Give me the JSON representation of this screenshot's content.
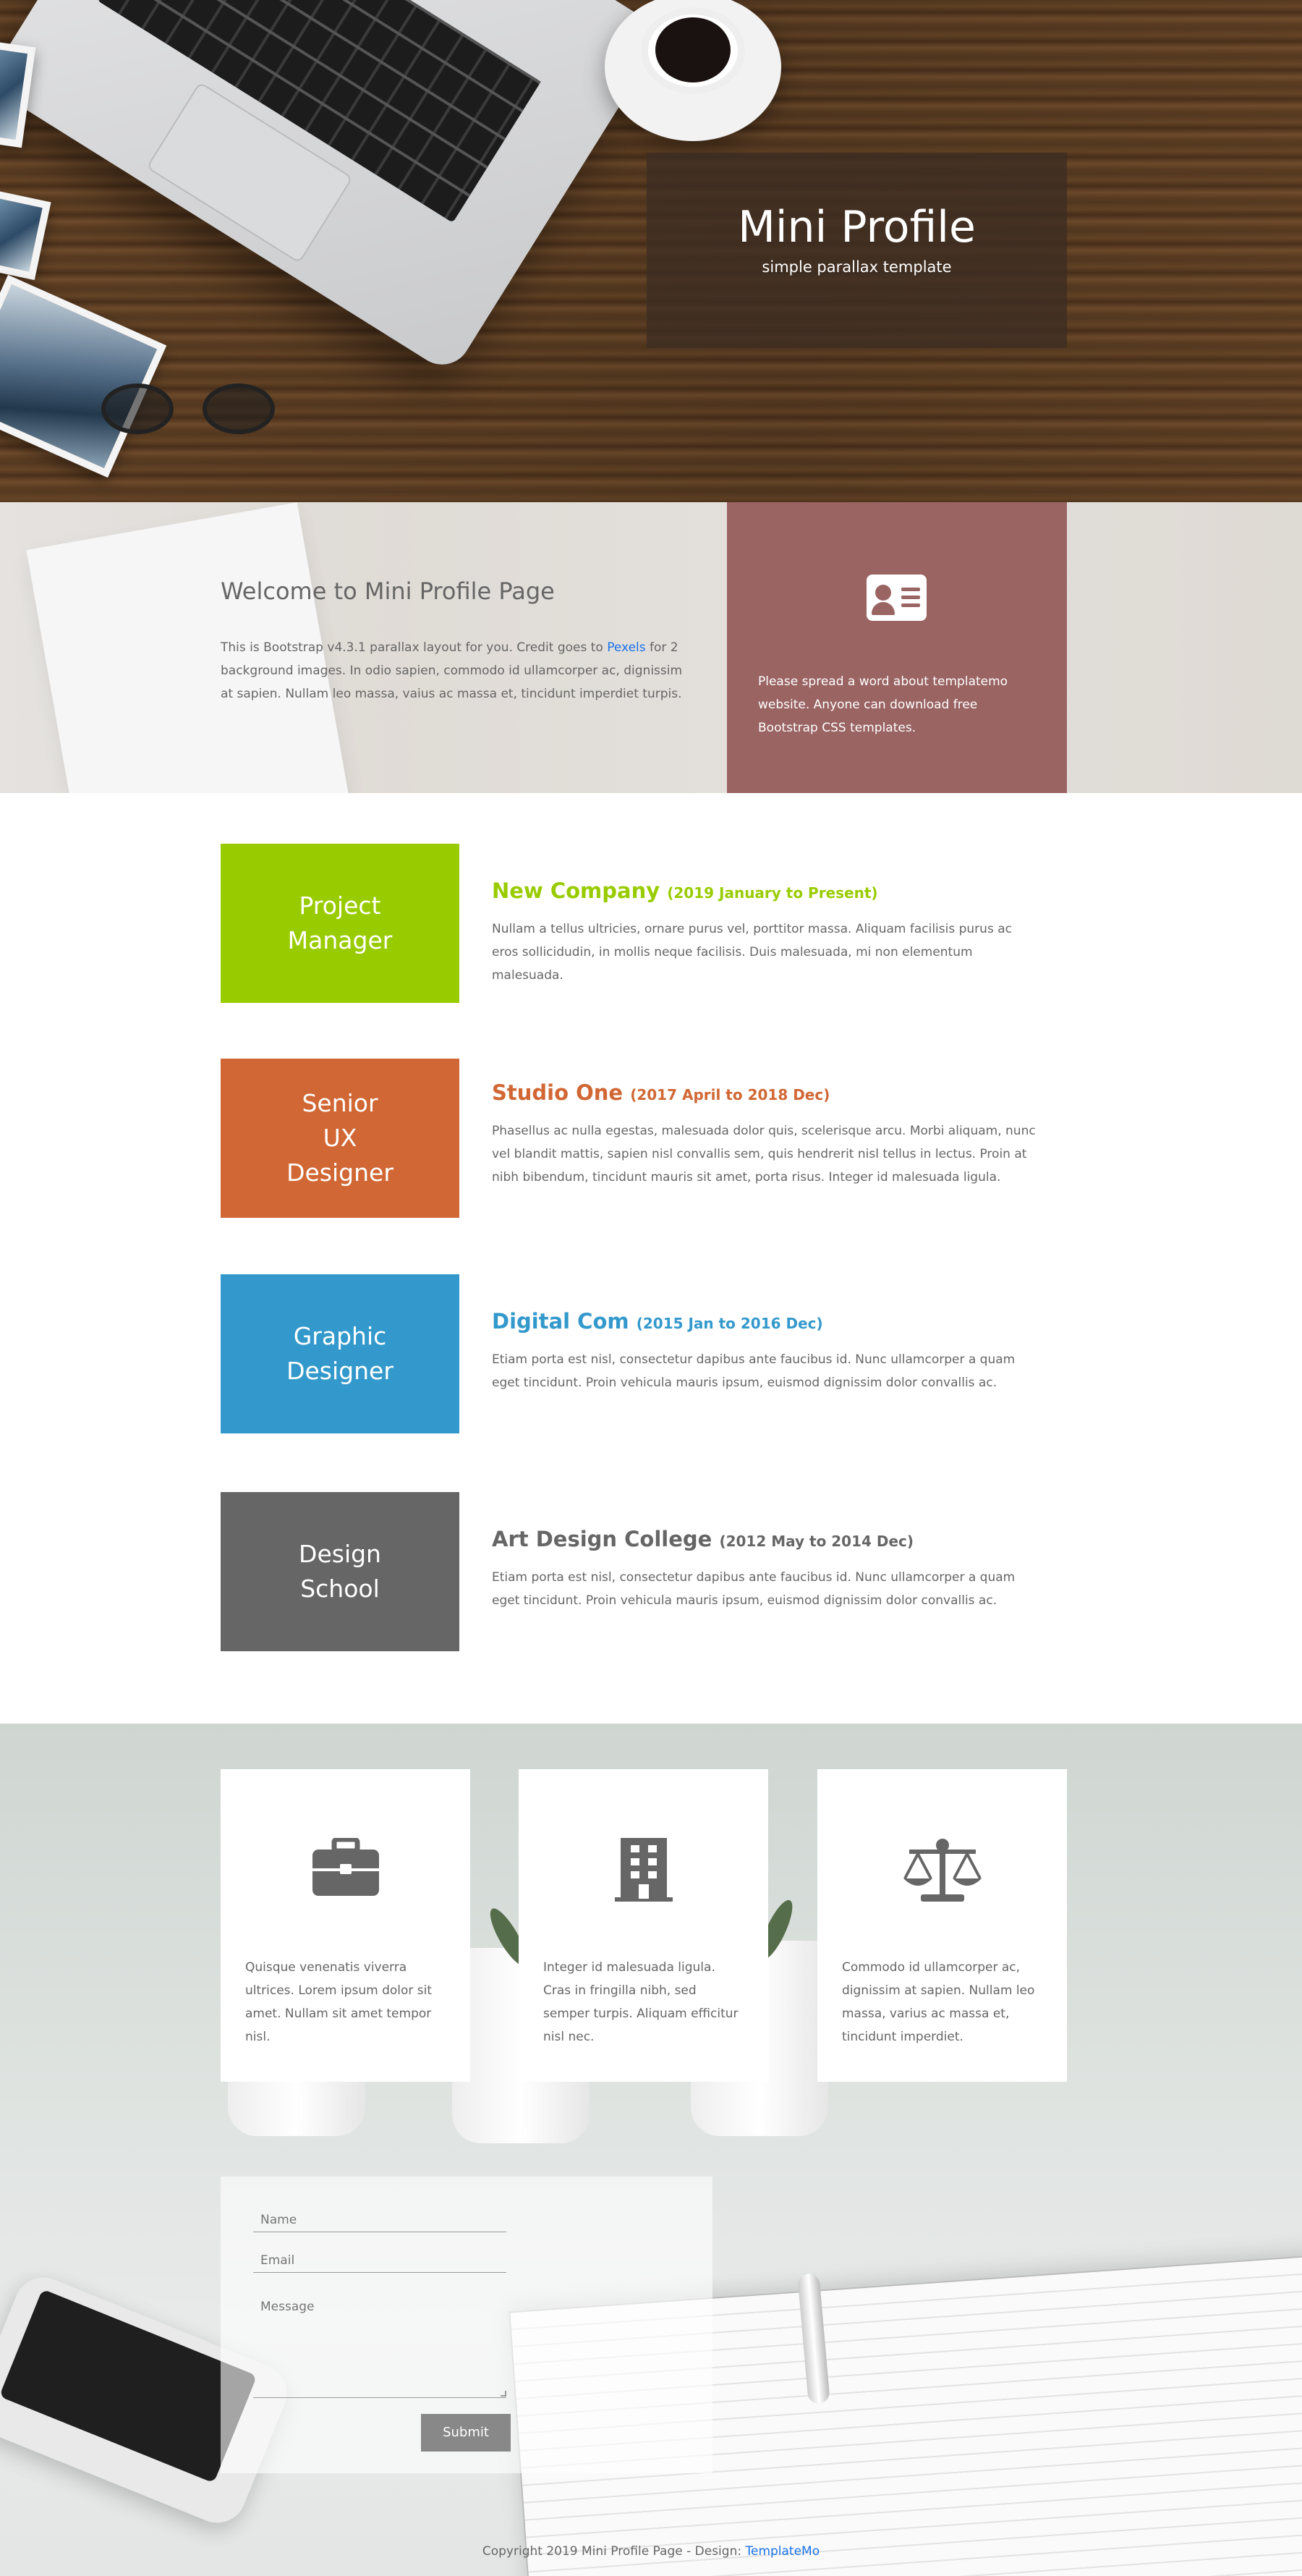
{
  "hero": {
    "title": "Mini Profile",
    "subtitle": "simple parallax template"
  },
  "welcome": {
    "title": "Welcome to Mini Profile Page",
    "text_before_link": "This is Bootstrap v4.3.1 parallax layout for you. Credit goes to ",
    "link_text": "Pexels",
    "text_after_link": " for 2 background images. In odio sapien, commodo id ullamcorper ac, dignissim at sapien. Nullam leo massa, vaius ac massa et, tincidunt imperdiet turpis."
  },
  "promo": {
    "icon": "address-card-icon",
    "text": "Please spread a word about templatemo website. Anyone can download free Bootstrap CSS templates.",
    "color": "#9a6463"
  },
  "timeline": [
    {
      "role": "Project\nManager",
      "company": "New Company",
      "dates": "(2019 January to Present)",
      "description": "Nullam a tellus ultricies, ornare purus vel, porttitor massa. Aliquam facilisis purus ac eros sollicidudin, in mollis neque facilisis. Duis malesuada, mi non elementum malesuada.",
      "color": "#99cc00"
    },
    {
      "role": "Senior\nUX\nDesigner",
      "company": "Studio One",
      "dates": "(2017 April to 2018 Dec)",
      "description": "Phasellus ac nulla egestas, malesuada dolor quis, scelerisque arcu. Morbi aliquam, nunc vel blandit mattis, sapien nisl convallis sem, quis hendrerit nisl tellus in lectus. Proin at nibh bibendum, tincidunt mauris sit amet, porta risus. Integer id malesuada ligula.",
      "color": "#d16734"
    },
    {
      "role": "Graphic\nDesigner",
      "company": "Digital Com",
      "dates": "(2015 Jan to 2016 Dec)",
      "description": "Etiam porta est nisl, consectetur dapibus ante faucibus id. Nunc ullamcorper a quam eget tincidunt. Proin vehicula mauris ipsum, euismod dignissim dolor convallis ac.",
      "color": "#3399cc"
    },
    {
      "role": "Design\nSchool",
      "company": "Art Design College",
      "dates": "(2012 May to 2014 Dec)",
      "description": "Etiam porta est nisl, consectetur dapibus ante faucibus id. Nunc ullamcorper a quam eget tincidunt. Proin vehicula mauris ipsum, euismod dignissim dolor convallis ac.",
      "color": "#666666"
    }
  ],
  "services": [
    {
      "icon": "briefcase-icon",
      "text": "Quisque venenatis viverra ultrices. Lorem ipsum dolor sit amet. Nullam sit amet tempor nisl."
    },
    {
      "icon": "building-icon",
      "text": "Integer id malesuada ligula. Cras in fringilla nibh, sed semper turpis. Aliquam efficitur nisl nec."
    },
    {
      "icon": "balance-scale-icon",
      "text": "Commodo id ullamcorper ac, dignissim at sapien. Nullam leo massa, varius ac massa et, tincidunt imperdiet."
    }
  ],
  "contact": {
    "name_placeholder": "Name",
    "email_placeholder": "Email",
    "message_placeholder": "Message",
    "submit_label": "Submit"
  },
  "footer": {
    "text": "Copyright 2019 Mini Profile Page - Design: ",
    "link_text": "TemplateMo"
  }
}
